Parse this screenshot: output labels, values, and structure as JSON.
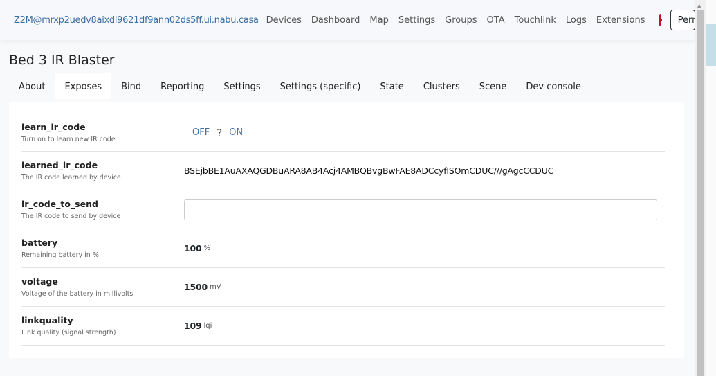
{
  "nav": {
    "brand": "Z2M@mrxp2uedv8aixdl9621df9ann02ds5ff.ui.nabu.casa",
    "links": [
      "Devices",
      "Dashboard",
      "Map",
      "Settings",
      "Groups",
      "OTA",
      "Touchlink",
      "Logs",
      "Extensions"
    ],
    "permit_join": "Permit join (All)"
  },
  "device": {
    "title": "Bed 3 IR Blaster"
  },
  "tabs": [
    "About",
    "Exposes",
    "Bind",
    "Reporting",
    "Settings",
    "Settings (specific)",
    "State",
    "Clusters",
    "Scene",
    "Dev console"
  ],
  "exposes": [
    {
      "name": "learn_ir_code",
      "desc": "Turn on to learn new IR code",
      "off": "OFF",
      "state": "?",
      "on": "ON"
    },
    {
      "name": "learned_ir_code",
      "desc": "The IR code learned by device",
      "value": "BSEjbBE1AuAXAQGDBuARA8AB4Acj4AMBQBvgBwFAE8ADCcyfISOmCDUC///gAgcCCDUC"
    },
    {
      "name": "ir_code_to_send",
      "desc": "The IR code to send by device",
      "value": ""
    },
    {
      "name": "battery",
      "desc": "Remaining battery in %",
      "value": "100",
      "unit": "%"
    },
    {
      "name": "voltage",
      "desc": "Voltage of the battery in millivolts",
      "value": "1500",
      "unit": "mV"
    },
    {
      "name": "linkquality",
      "desc": "Link quality (signal strength)",
      "value": "109",
      "unit": "lqi"
    }
  ]
}
